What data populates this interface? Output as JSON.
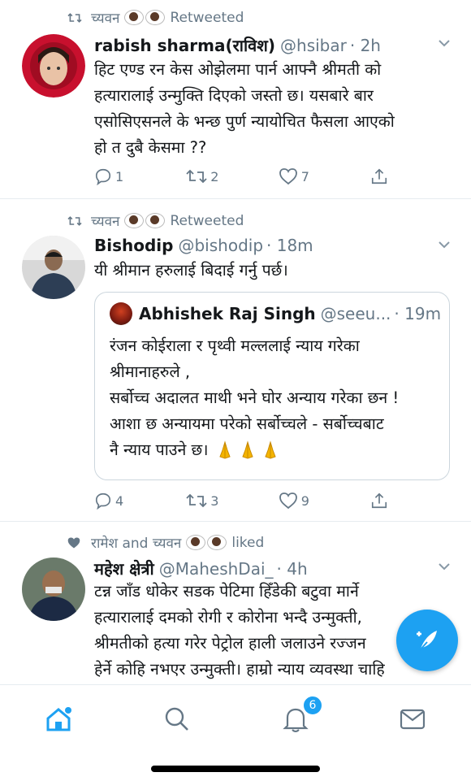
{
  "tweets": [
    {
      "social_user": "च्यवन",
      "social_action": "Retweeted",
      "name": "rabish sharma(राविश)",
      "handle": "@hsibar",
      "time": "· 2h",
      "text_lines": [
        "हिट एण्ड रन केस ओझेलमा पार्न आफ्नै श्रीमती को",
        "हत्यारालाई उन्मुक्ति दिएको जस्तो छ।  यसबारे बार",
        "एसोसिएसनले के भन्छ पुर्ण न्यायोचित फैसला आएको",
        "हो त दुबै केसमा ??"
      ],
      "replies": "1",
      "retweets": "2",
      "likes": "7"
    },
    {
      "social_user": "च्यवन",
      "social_action": "Retweeted",
      "name": "Bishodip",
      "handle": "@bishodip",
      "time": "· 18m",
      "text_lines": [
        "यी श्रीमान हरुलाई बिदाई गर्नु पर्छ।"
      ],
      "quote": {
        "name": "Abhishek Raj Singh",
        "handle": "@seeu...",
        "time": "· 19m",
        "text_lines": [
          "रंजन कोईराला र पृथ्वी मल्ललाई न्याय गरेका",
          "श्रीमानाहरुले ,",
          "सर्बोच्च अदालत माथी भने घोर अन्याय गरेका छन !",
          "आशा छ अन्यायमा परेको सर्बोच्चले - सर्बोच्चबाट",
          "नै न्याय पाउने छ।"
        ]
      },
      "replies": "4",
      "retweets": "3",
      "likes": "9"
    },
    {
      "social_user": "रामेश and च्यवन",
      "social_action": "liked",
      "name": "महेश क्षेत्री",
      "handle": "@MaheshDai_",
      "time": "· 4h",
      "text_lines": [
        "टन्न जाँड धोकेर सडक पेटिमा हिँडेकी बटुवा मार्ने",
        "हत्यारालाई दमको रोगी र कोरोना भन्दै उन्मुक्ती,",
        "श्रीमतीको हत्या गरेर पेट्रोल हाली जलाउने रज्जन",
        "हेर्ने कोहि नभएर उन्मुक्ती।  हाम्रो न्याय व्यवस्था चाहि"
      ]
    }
  ],
  "tabbar": {
    "notifications_badge": "6",
    "icons": [
      "home-icon",
      "search-icon",
      "bell-icon",
      "mail-icon"
    ]
  },
  "colors": {
    "accent": "#1da1f2",
    "muted": "#657786",
    "text": "#14171a",
    "divider": "#e6ecf0"
  }
}
